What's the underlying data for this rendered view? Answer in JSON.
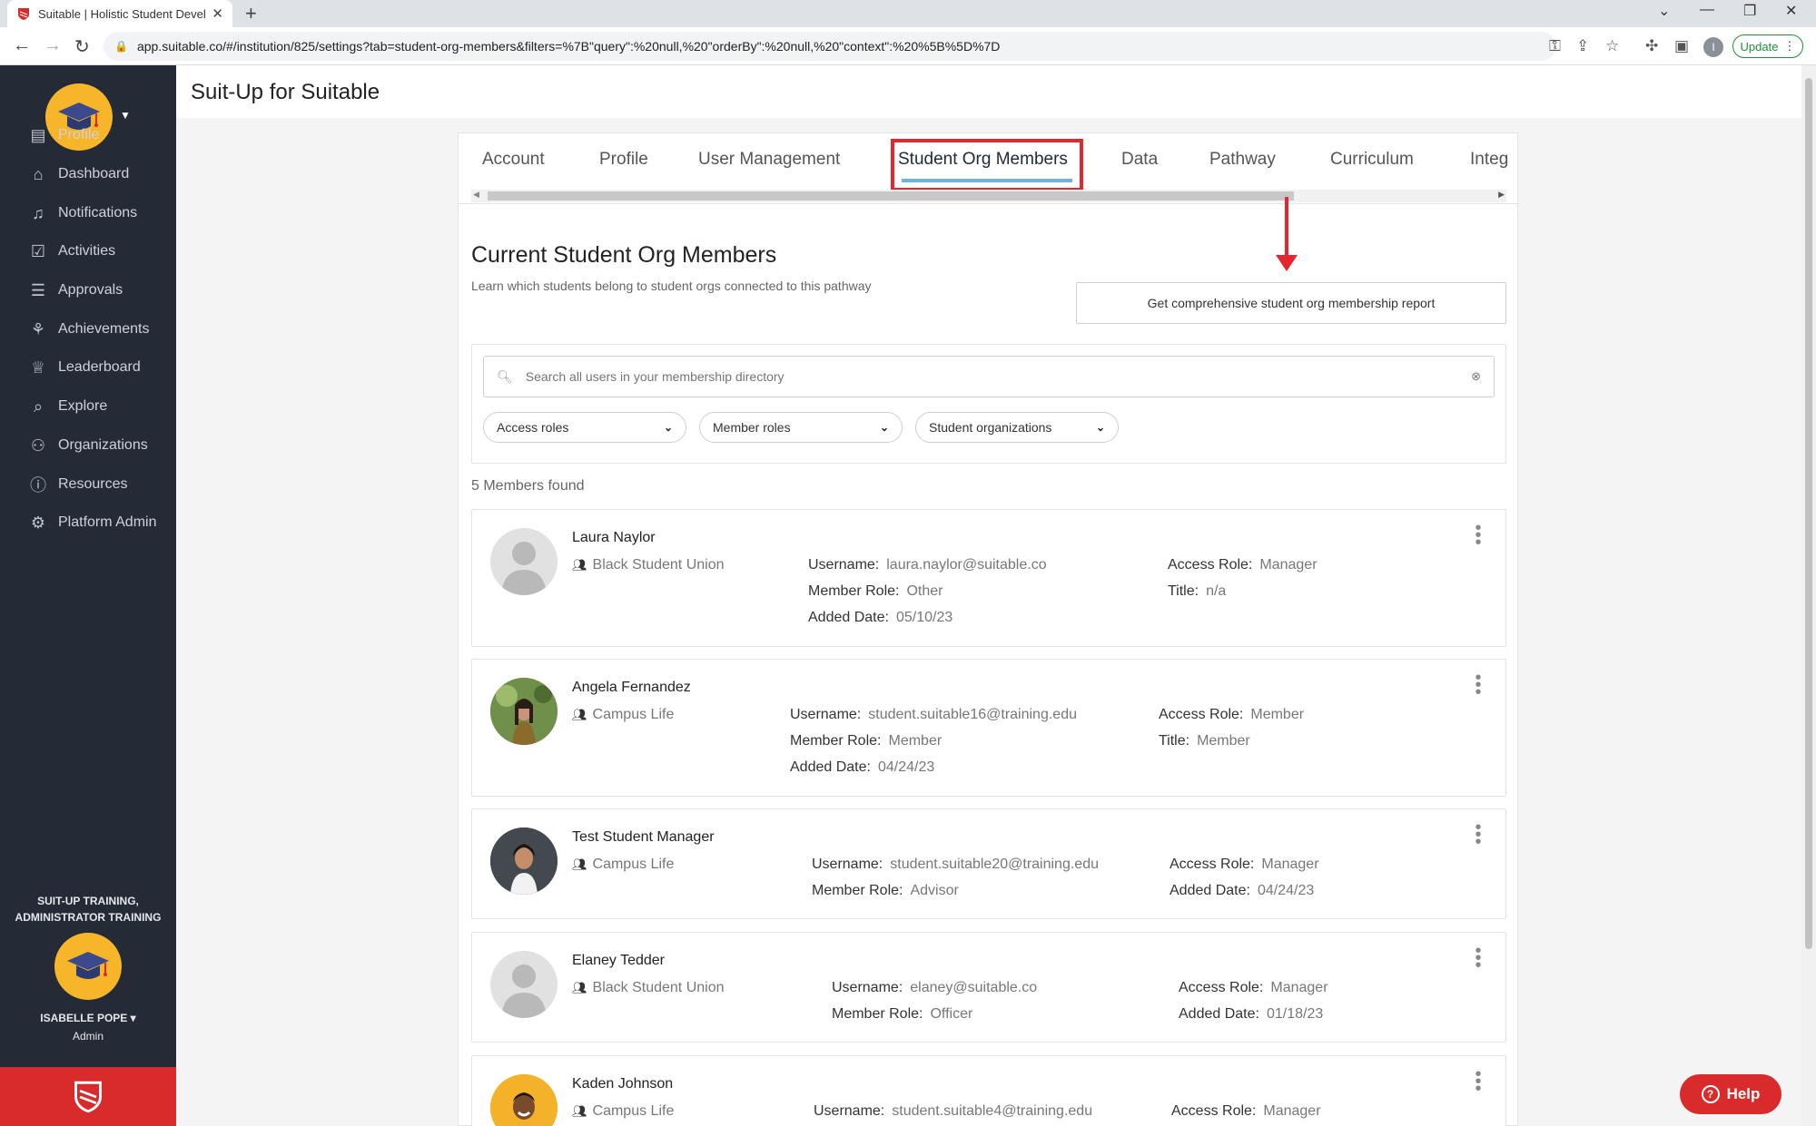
{
  "browser": {
    "tab_title": "Suitable | Holistic Student Develo",
    "url": "app.suitable.co/#/institution/825/settings?tab=student-org-members&filters=%7B\"query\":%20null,%20\"orderBy\":%20null,%20\"context\":%20%5B%5D%7D",
    "update_label": "Update",
    "profile_initial": "I"
  },
  "sidebar": {
    "items": [
      {
        "label": "Profile",
        "icon": "profile-card-icon"
      },
      {
        "label": "Dashboard",
        "icon": "dashboard-icon"
      },
      {
        "label": "Notifications",
        "icon": "bell-icon"
      },
      {
        "label": "Activities",
        "icon": "checkbox-icon"
      },
      {
        "label": "Approvals",
        "icon": "list-icon"
      },
      {
        "label": "Achievements",
        "icon": "medal-icon"
      },
      {
        "label": "Leaderboard",
        "icon": "trophy-icon"
      },
      {
        "label": "Explore",
        "icon": "explore-icon"
      },
      {
        "label": "Organizations",
        "icon": "people-icon"
      },
      {
        "label": "Resources",
        "icon": "info-icon"
      },
      {
        "label": "Platform Admin",
        "icon": "gear-icon"
      }
    ],
    "org_line1": "SUIT-UP TRAINING,",
    "org_line2": "ADMINISTRATOR TRAINING",
    "user_name": "ISABELLE POPE",
    "user_role": "Admin"
  },
  "header": {
    "title": "Suit-Up for Suitable"
  },
  "settings_tabs": [
    "Account",
    "Profile",
    "User Management",
    "Student Org Members",
    "Data",
    "Pathway",
    "Curriculum",
    "Integ"
  ],
  "main": {
    "section_title": "Current Student Org Members",
    "section_desc": "Learn which students belong to student orgs connected to this pathway",
    "report_button": "Get comprehensive student org membership report",
    "search_placeholder": "Search all users in your membership directory",
    "filters": [
      "Access roles",
      "Member roles",
      "Student organizations"
    ],
    "found": "5 Members found"
  },
  "labels": {
    "username": "Username:",
    "member_role": "Member Role:",
    "added_date": "Added Date:",
    "access_role": "Access Role:",
    "title": "Title:"
  },
  "members": [
    {
      "name": "Laura Naylor",
      "org": "Black Student Union",
      "username": "laura.naylor@suitable.co",
      "member_role": "Other",
      "added_date": "05/10/23",
      "access_role": "Manager",
      "title": "n/a"
    },
    {
      "name": "Angela Fernandez",
      "org": "Campus Life",
      "username": "student.suitable16@training.edu",
      "member_role": "Member",
      "added_date": "04/24/23",
      "access_role": "Member",
      "title": "Member"
    },
    {
      "name": "Test Student Manager",
      "org": "Campus Life",
      "username": "student.suitable20@training.edu",
      "member_role": "Advisor",
      "access_role": "Manager",
      "added_date": "04/24/23"
    },
    {
      "name": "Elaney Tedder",
      "org": "Black Student Union",
      "username": "elaney@suitable.co",
      "member_role": "Officer",
      "access_role": "Manager",
      "added_date": "01/18/23"
    },
    {
      "name": "Kaden Johnson",
      "org": "Campus Life",
      "username": "student.suitable4@training.edu",
      "access_role": "Manager"
    }
  ],
  "help_label": "Help",
  "colors": {
    "accent_red": "#d92b2b",
    "sidebar_bg": "#252b36",
    "logo_yellow": "#f7b529",
    "tab_underline": "#6fb3e0"
  }
}
